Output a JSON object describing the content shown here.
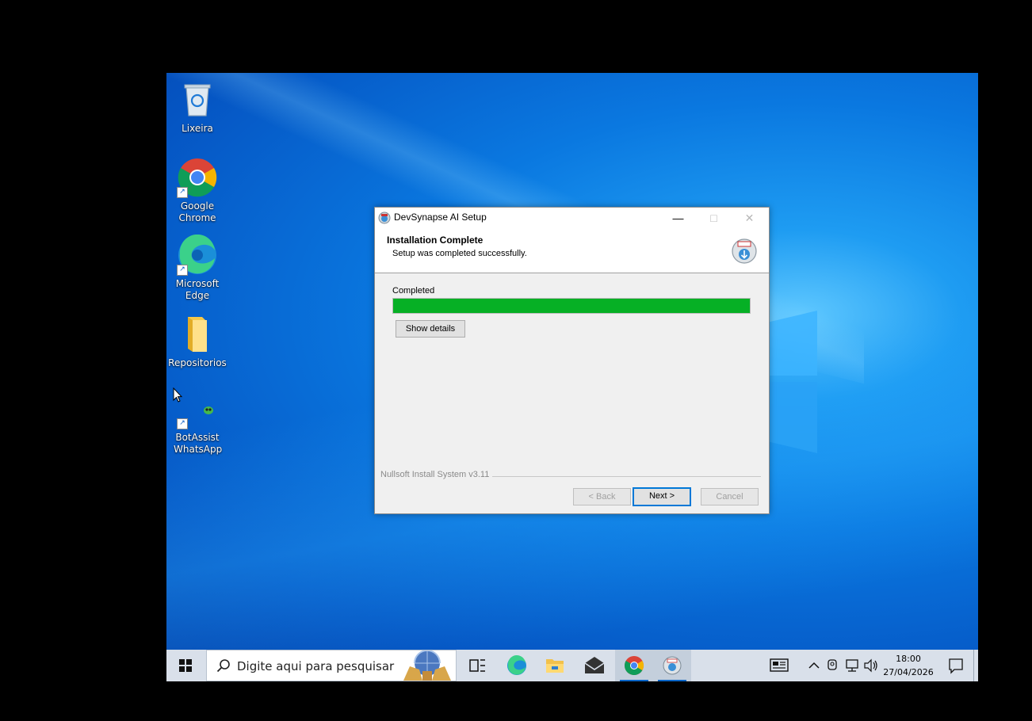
{
  "desktop": {
    "icons": [
      {
        "label": "Lixeira",
        "icon": "recycle-bin-icon"
      },
      {
        "label": "Google Chrome",
        "icon": "chrome-icon"
      },
      {
        "label": "Microsoft Edge",
        "icon": "edge-icon"
      },
      {
        "label": "Repositorios",
        "icon": "folder-icon"
      },
      {
        "label": "BotAssist WhatsApp",
        "icon": "bot-icon"
      }
    ]
  },
  "dialog": {
    "title": "DevSynapse AI Setup",
    "header_title": "Installation Complete",
    "header_subtitle": "Setup was completed successfully.",
    "status": "Completed",
    "progress": 1.0,
    "show_details": "Show details",
    "branding": "Nullsoft Install System v3.11",
    "back": "< Back",
    "next": "Next >",
    "cancel": "Cancel",
    "progress_color": "#06b025"
  },
  "taskbar": {
    "search_placeholder": "Digite aqui para pesquisar",
    "time": "18:00",
    "date": "27/04/2026"
  }
}
